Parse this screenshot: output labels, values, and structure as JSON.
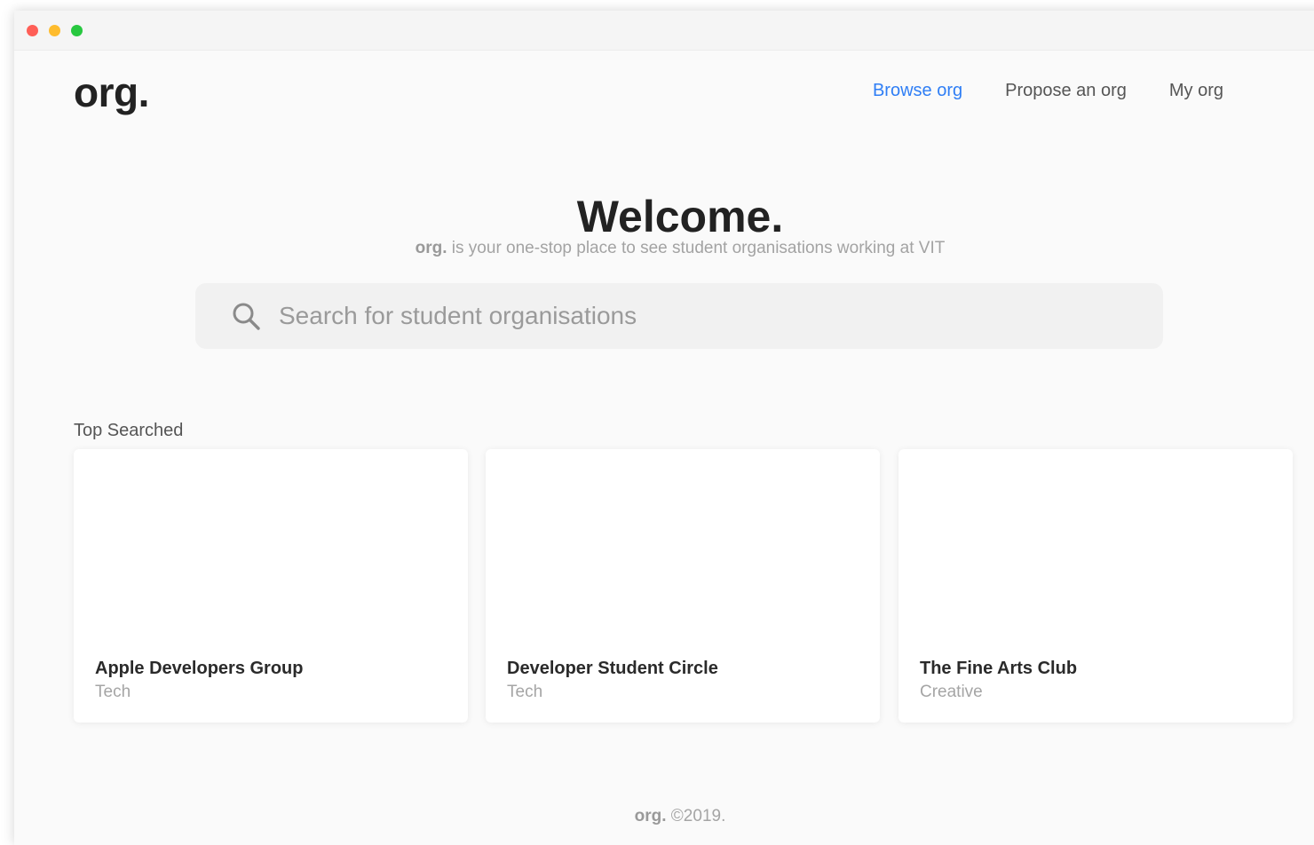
{
  "app": {
    "logo": "org."
  },
  "nav": {
    "items": [
      {
        "label": "Browse org",
        "active": true
      },
      {
        "label": "Propose an org",
        "active": false
      },
      {
        "label": "My org",
        "active": false
      }
    ],
    "active_color": "#2f7ef5"
  },
  "hero": {
    "title": "Welcome.",
    "tagline_brand": "org.",
    "tagline_text": " is your one-stop place to see student organisations working at VIT"
  },
  "search": {
    "placeholder": "Search for student organisations",
    "value": "",
    "icon": "search-icon"
  },
  "top_searched": {
    "label": "Top Searched",
    "cards": [
      {
        "name": "Apple Developers Group",
        "category": "Tech"
      },
      {
        "name": "Developer Student Circle",
        "category": "Tech"
      },
      {
        "name": "The Fine Arts Club",
        "category": "Creative"
      }
    ]
  },
  "footer": {
    "brand": "org.",
    "text": " ©2019."
  }
}
